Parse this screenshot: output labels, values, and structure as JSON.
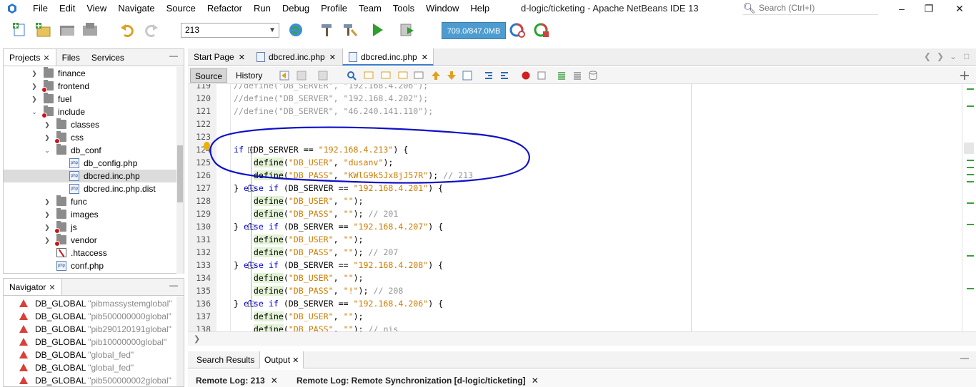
{
  "window": {
    "title": "d-logic/ticketing - Apache NetBeans IDE 13",
    "search_placeholder": "Search (Ctrl+I)"
  },
  "menu": [
    "File",
    "Edit",
    "View",
    "Navigate",
    "Source",
    "Refactor",
    "Run",
    "Debug",
    "Profile",
    "Team",
    "Tools",
    "Window",
    "Help"
  ],
  "toolbar": {
    "config_value": "213",
    "memory": "709.0/847.0MB"
  },
  "projects_panel": {
    "tabs": [
      {
        "label": "Projects",
        "closable": true
      },
      {
        "label": "Files",
        "closable": false
      },
      {
        "label": "Services",
        "closable": false
      }
    ],
    "tree": [
      {
        "label": "finance",
        "type": "folder",
        "state": "collapsed",
        "error": false
      },
      {
        "label": "frontend",
        "type": "folder",
        "state": "collapsed",
        "error": true
      },
      {
        "label": "fuel",
        "type": "folder",
        "state": "collapsed",
        "error": false
      },
      {
        "label": "include",
        "type": "folder",
        "state": "expanded",
        "error": true
      },
      {
        "label": "classes",
        "type": "folder",
        "state": "collapsed",
        "error": false
      },
      {
        "label": "css",
        "type": "folder",
        "state": "collapsed",
        "error": true
      },
      {
        "label": "db_conf",
        "type": "folder",
        "state": "expanded",
        "error": false
      },
      {
        "label": "db_config.php",
        "type": "php",
        "state": "leaf",
        "error": false
      },
      {
        "label": "dbcred.inc.php",
        "type": "php",
        "state": "leaf",
        "error": false,
        "selected": true
      },
      {
        "label": "dbcred.inc.php.dist",
        "type": "php",
        "state": "leaf",
        "error": false
      },
      {
        "label": "func",
        "type": "folder",
        "state": "collapsed",
        "error": false
      },
      {
        "label": "images",
        "type": "folder",
        "state": "collapsed",
        "error": false
      },
      {
        "label": "js",
        "type": "folder",
        "state": "collapsed",
        "error": true
      },
      {
        "label": "vendor",
        "type": "folder",
        "state": "collapsed",
        "error": true
      },
      {
        "label": ".htaccess",
        "type": "htaccess",
        "state": "leaf",
        "error": false
      },
      {
        "label": "conf.php",
        "type": "php",
        "state": "leaf",
        "error": false
      }
    ]
  },
  "navigator": {
    "title": "Navigator",
    "items": [
      {
        "name": "DB_GLOBAL",
        "value": "\"pibmassystemglobal\""
      },
      {
        "name": "DB_GLOBAL",
        "value": "\"pib500000000global\""
      },
      {
        "name": "DB_GLOBAL",
        "value": "\"pib290120191global\""
      },
      {
        "name": "DB_GLOBAL",
        "value": "\"pib10000000global\""
      },
      {
        "name": "DB_GLOBAL",
        "value": "\"global_fed\""
      },
      {
        "name": "DB_GLOBAL",
        "value": "\"global_fed\""
      },
      {
        "name": "DB_GLOBAL",
        "value": "\"pib500000002global\""
      }
    ]
  },
  "editor": {
    "tabs": [
      {
        "label": "Start Page",
        "active": false,
        "file": false
      },
      {
        "label": "dbcred.inc.php",
        "active": false,
        "file": true
      },
      {
        "label": "dbcred.inc.php",
        "active": true,
        "file": true
      }
    ],
    "modes": [
      "Source",
      "History"
    ],
    "lines": [
      {
        "n": "119",
        "tokens": [
          {
            "c": "cmt",
            "t": "//define(\"DB_SERVER\", \"192.168.4.206\");"
          }
        ]
      },
      {
        "n": "120",
        "tokens": [
          {
            "c": "cmt",
            "t": "//define(\"DB_SERVER\", \"192.168.4.202\");"
          }
        ]
      },
      {
        "n": "121",
        "tokens": [
          {
            "c": "cmt",
            "t": "//define(\"DB_SERVER\", \"46.240.141.110\");"
          }
        ]
      },
      {
        "n": "122",
        "tokens": []
      },
      {
        "n": "123",
        "tokens": []
      },
      {
        "n": "124",
        "tokens": [
          {
            "c": "kw",
            "t": "if"
          },
          {
            "c": "plain",
            "t": " (DB_SERVER == "
          },
          {
            "c": "str",
            "t": "\"192.168.4.213\""
          },
          {
            "c": "plain",
            "t": ") {"
          }
        ]
      },
      {
        "n": "125",
        "tokens": [
          {
            "c": "plain",
            "t": "    "
          },
          {
            "c": "fn",
            "t": "define"
          },
          {
            "c": "plain",
            "t": "("
          },
          {
            "c": "str",
            "t": "\"DB_USER\""
          },
          {
            "c": "plain",
            "t": ", "
          },
          {
            "c": "str",
            "t": "\"dusanv\""
          },
          {
            "c": "plain",
            "t": ");"
          }
        ]
      },
      {
        "n": "126",
        "tokens": [
          {
            "c": "plain",
            "t": "    "
          },
          {
            "c": "fn",
            "t": "define"
          },
          {
            "c": "plain",
            "t": "("
          },
          {
            "c": "str",
            "t": "\"DB_PASS\""
          },
          {
            "c": "plain",
            "t": ", "
          },
          {
            "c": "str",
            "t": "\"KWlG9k5Jx8jJ57R\""
          },
          {
            "c": "plain",
            "t": "); "
          },
          {
            "c": "cmt",
            "t": "// 213"
          }
        ]
      },
      {
        "n": "127",
        "tokens": [
          {
            "c": "plain",
            "t": "} "
          },
          {
            "c": "kw",
            "t": "else if"
          },
          {
            "c": "plain",
            "t": " (DB_SERVER == "
          },
          {
            "c": "str",
            "t": "\"192.168.4.201\""
          },
          {
            "c": "plain",
            "t": ") {"
          }
        ]
      },
      {
        "n": "128",
        "tokens": [
          {
            "c": "plain",
            "t": "    "
          },
          {
            "c": "fn",
            "t": "define"
          },
          {
            "c": "plain",
            "t": "("
          },
          {
            "c": "str",
            "t": "\"DB_USER\""
          },
          {
            "c": "plain",
            "t": ", "
          },
          {
            "c": "str",
            "t": "\"\""
          },
          {
            "c": "plain",
            "t": ");"
          }
        ]
      },
      {
        "n": "129",
        "tokens": [
          {
            "c": "plain",
            "t": "    "
          },
          {
            "c": "fn",
            "t": "define"
          },
          {
            "c": "plain",
            "t": "("
          },
          {
            "c": "str",
            "t": "\"DB_PASS\""
          },
          {
            "c": "plain",
            "t": ", "
          },
          {
            "c": "str",
            "t": "\"\""
          },
          {
            "c": "plain",
            "t": "); "
          },
          {
            "c": "cmt",
            "t": "// 201"
          }
        ]
      },
      {
        "n": "130",
        "tokens": [
          {
            "c": "plain",
            "t": "} "
          },
          {
            "c": "kw",
            "t": "else if"
          },
          {
            "c": "plain",
            "t": " (DB_SERVER == "
          },
          {
            "c": "str",
            "t": "\"192.168.4.207\""
          },
          {
            "c": "plain",
            "t": ") {"
          }
        ]
      },
      {
        "n": "131",
        "tokens": [
          {
            "c": "plain",
            "t": "    "
          },
          {
            "c": "fn",
            "t": "define"
          },
          {
            "c": "plain",
            "t": "("
          },
          {
            "c": "str",
            "t": "\"DB_USER\""
          },
          {
            "c": "plain",
            "t": ", "
          },
          {
            "c": "str",
            "t": "\"\""
          },
          {
            "c": "plain",
            "t": ");"
          }
        ]
      },
      {
        "n": "132",
        "tokens": [
          {
            "c": "plain",
            "t": "    "
          },
          {
            "c": "fn",
            "t": "define"
          },
          {
            "c": "plain",
            "t": "("
          },
          {
            "c": "str",
            "t": "\"DB_PASS\""
          },
          {
            "c": "plain",
            "t": ", "
          },
          {
            "c": "str",
            "t": "\"\""
          },
          {
            "c": "plain",
            "t": "); "
          },
          {
            "c": "cmt",
            "t": "// 207"
          }
        ]
      },
      {
        "n": "133",
        "tokens": [
          {
            "c": "plain",
            "t": "} "
          },
          {
            "c": "kw",
            "t": "else if"
          },
          {
            "c": "plain",
            "t": " (DB_SERVER == "
          },
          {
            "c": "str",
            "t": "\"192.168.4.208\""
          },
          {
            "c": "plain",
            "t": ") {"
          }
        ]
      },
      {
        "n": "134",
        "tokens": [
          {
            "c": "plain",
            "t": "    "
          },
          {
            "c": "fn",
            "t": "define"
          },
          {
            "c": "plain",
            "t": "("
          },
          {
            "c": "str",
            "t": "\"DB_USER\""
          },
          {
            "c": "plain",
            "t": ", "
          },
          {
            "c": "str",
            "t": "\"\""
          },
          {
            "c": "plain",
            "t": ");"
          }
        ]
      },
      {
        "n": "135",
        "tokens": [
          {
            "c": "plain",
            "t": "    "
          },
          {
            "c": "fn",
            "t": "define"
          },
          {
            "c": "plain",
            "t": "("
          },
          {
            "c": "str",
            "t": "\"DB_PASS\""
          },
          {
            "c": "plain",
            "t": ", "
          },
          {
            "c": "str",
            "t": "\"!\""
          },
          {
            "c": "plain",
            "t": "); "
          },
          {
            "c": "cmt",
            "t": "// 208"
          }
        ]
      },
      {
        "n": "136",
        "tokens": [
          {
            "c": "plain",
            "t": "} "
          },
          {
            "c": "kw",
            "t": "else if"
          },
          {
            "c": "plain",
            "t": " (DB_SERVER == "
          },
          {
            "c": "str",
            "t": "\"192.168.4.206\""
          },
          {
            "c": "plain",
            "t": ") {"
          }
        ]
      },
      {
        "n": "137",
        "tokens": [
          {
            "c": "plain",
            "t": "    "
          },
          {
            "c": "fn",
            "t": "define"
          },
          {
            "c": "plain",
            "t": "("
          },
          {
            "c": "str",
            "t": "\"DB_USER\""
          },
          {
            "c": "plain",
            "t": ", "
          },
          {
            "c": "str",
            "t": "\"\""
          },
          {
            "c": "plain",
            "t": ");"
          }
        ]
      },
      {
        "n": "138",
        "tokens": [
          {
            "c": "plain",
            "t": "    "
          },
          {
            "c": "fn",
            "t": "define"
          },
          {
            "c": "plain",
            "t": "("
          },
          {
            "c": "str",
            "t": "\"DB_PASS\""
          },
          {
            "c": "plain",
            "t": ", "
          },
          {
            "c": "str",
            "t": "\"\""
          },
          {
            "c": "plain",
            "t": "); "
          },
          {
            "c": "cmt",
            "t": "// nis"
          }
        ]
      }
    ]
  },
  "output": {
    "tabs": [
      {
        "label": "Search Results",
        "active": false,
        "closable": false
      },
      {
        "label": "Output",
        "active": true,
        "closable": true
      }
    ],
    "subtabs": [
      "Remote Log: 213",
      "Remote Log: Remote Synchronization [d-logic/ticketing]"
    ]
  },
  "colors": {
    "keyword": "#0000e6",
    "string": "#ce7b00",
    "comment": "#969696",
    "function_bg": "#e2f2d5",
    "annotation_ink": "#1010c8",
    "memory_bar": "#4e9ccf",
    "error_badge": "#c8161d"
  },
  "icons": [
    "netbeans-logo",
    "new-file-icon",
    "new-project-icon",
    "open-project-icon",
    "close-project-icon",
    "undo-icon",
    "redo-icon",
    "globe-icon",
    "hammer-icon",
    "clean-build-icon",
    "run-icon",
    "debug-icon",
    "profile-icon",
    "search-icon"
  ]
}
